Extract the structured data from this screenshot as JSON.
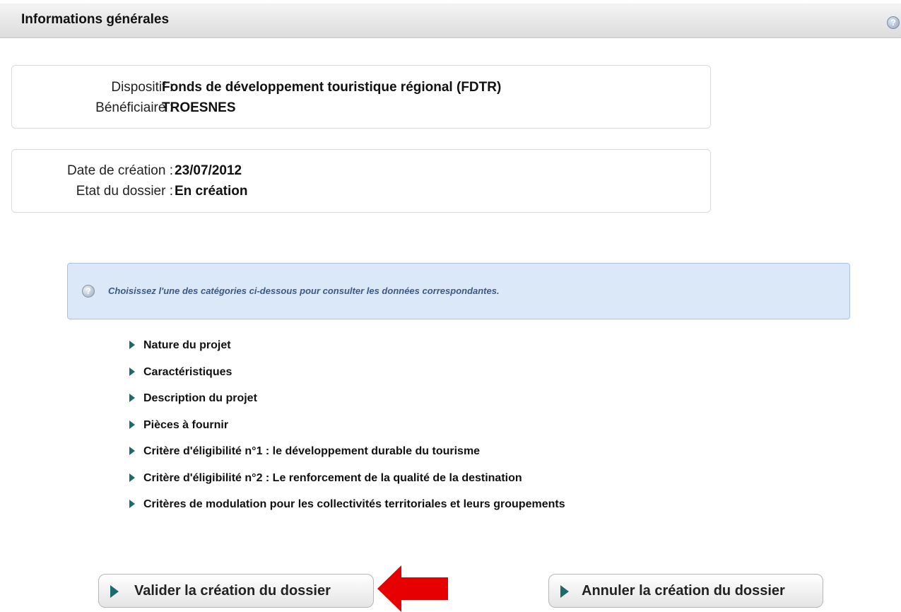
{
  "header": {
    "title": "Informations générales",
    "help_icon": "help-icon"
  },
  "program_box": {
    "dispositif_label": "Dispositif :",
    "dispositif_value": "Fonds de développement touristique régional (FDTR)",
    "beneficiaire_label": "Bénéficiaire :",
    "beneficiaire_value": "TROESNES"
  },
  "status_box": {
    "date_label": "Date de création :",
    "date_value": "23/07/2012",
    "etat_label": "Etat du dossier :",
    "etat_value": "En création"
  },
  "notice": {
    "text": "Choisissez l'une des catégories ci-dessous pour consulter les données correspondantes."
  },
  "categories": [
    "Nature du projet",
    "Caractéristiques",
    "Description du projet",
    "Pièces à fournir",
    "Critère d'éligibilité n°1 : le développement durable du tourisme",
    "Critère d'éligibilité n°2 : Le renforcement de la qualité de la destination",
    "Critères de modulation pour les collectivités territoriales et leurs groupements"
  ],
  "actions": {
    "validate_label": "Valider la création du dossier",
    "cancel_label": "Annuler la création du dossier"
  },
  "colors": {
    "accent_chevron": "#1d6a6a",
    "notice_bg": "#dbe8f7",
    "pointer_arrow": "#e60000"
  }
}
